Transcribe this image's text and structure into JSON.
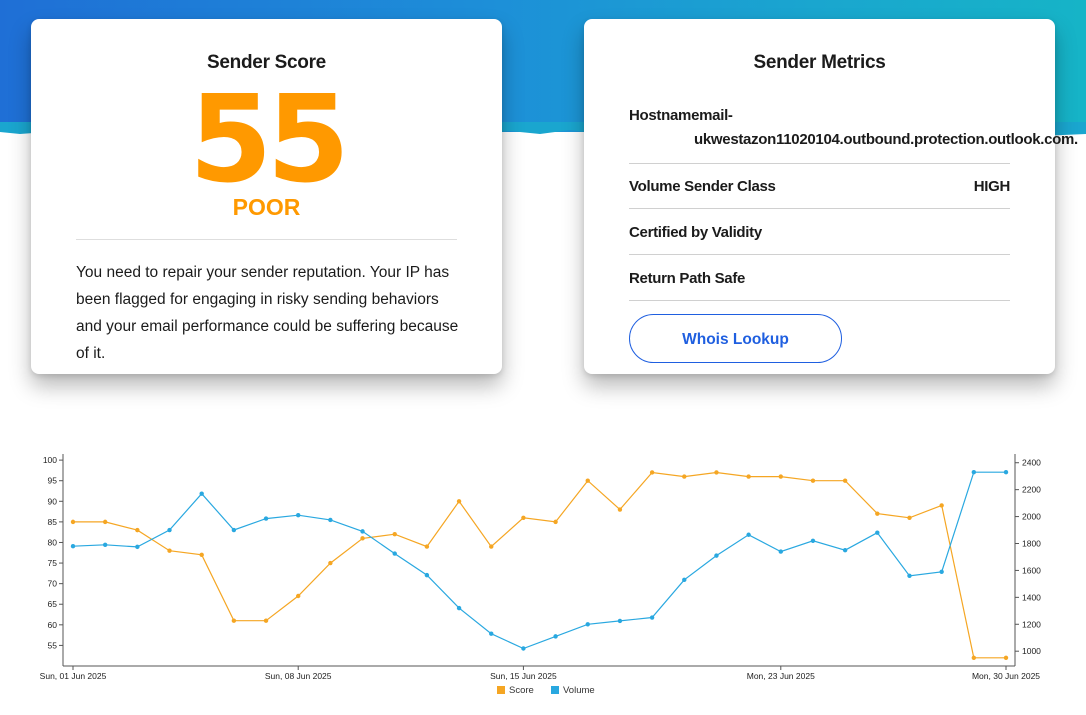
{
  "colors": {
    "accent_orange": "#ff9900",
    "link_blue": "#1f5fe0",
    "score_line": "#f5a623",
    "volume_line": "#29a8e0",
    "banner_from": "#1f6fd6",
    "banner_to": "#16b4c7"
  },
  "score_card": {
    "title": "Sender Score",
    "score": "55",
    "rating": "POOR",
    "description": "You need to repair your sender reputation. Your IP has been flagged for engaging in risky sending behaviors and your email performance could be suffering because of it."
  },
  "metrics_card": {
    "title": "Sender Metrics",
    "hostname_label": "Hostnamemail-",
    "hostname_value": "ukwestazon11020104.outbound.protection.outlook.com.",
    "volume_label": "Volume Sender Class",
    "volume_value": "HIGH",
    "certified_label": "Certified by Validity",
    "return_path_label": "Return Path Safe",
    "whois_button": "Whois Lookup"
  },
  "chart_data": {
    "type": "line",
    "x": [
      "2025-06-01",
      "2025-06-02",
      "2025-06-03",
      "2025-06-04",
      "2025-06-05",
      "2025-06-06",
      "2025-06-07",
      "2025-06-08",
      "2025-06-09",
      "2025-06-10",
      "2025-06-11",
      "2025-06-12",
      "2025-06-13",
      "2025-06-14",
      "2025-06-15",
      "2025-06-16",
      "2025-06-17",
      "2025-06-18",
      "2025-06-19",
      "2025-06-20",
      "2025-06-21",
      "2025-06-22",
      "2025-06-23",
      "2025-06-24",
      "2025-06-25",
      "2025-06-26",
      "2025-06-27",
      "2025-06-28",
      "2025-06-29",
      "2025-06-30"
    ],
    "x_tick_labels": [
      "Sun, 01 Jun 2025",
      "Sun, 08 Jun 2025",
      "Sun, 15 Jun 2025",
      "Mon, 23 Jun 2025",
      "Mon, 30 Jun 2025"
    ],
    "x_tick_dates": [
      "2025-06-01",
      "2025-06-08",
      "2025-06-15",
      "2025-06-23",
      "2025-06-30"
    ],
    "series": [
      {
        "name": "Score",
        "axis": "left",
        "color": "#f5a623",
        "values": [
          85,
          85,
          83,
          78,
          77,
          61,
          61,
          67,
          75,
          81,
          82,
          79,
          90,
          79,
          86,
          85,
          95,
          88,
          97,
          96,
          97,
          96,
          96,
          95,
          95,
          87,
          86,
          89,
          52,
          52
        ]
      },
      {
        "name": "Volume",
        "axis": "right",
        "color": "#29a8e0",
        "values": [
          1780,
          1790,
          1775,
          1900,
          2170,
          1900,
          1985,
          2010,
          1975,
          1890,
          1725,
          1565,
          1320,
          1130,
          1020,
          1110,
          1200,
          1225,
          1250,
          1530,
          1710,
          1865,
          1740,
          1820,
          1750,
          1880,
          1560,
          1590,
          2330,
          2330
        ]
      }
    ],
    "y_left": {
      "ticks": [
        55,
        60,
        65,
        70,
        75,
        80,
        85,
        90,
        95,
        100
      ],
      "ylim": [
        50,
        101
      ]
    },
    "y_right": {
      "ticks": [
        1000,
        1200,
        1400,
        1600,
        1800,
        2000,
        2200,
        2400
      ],
      "ylim": [
        890,
        2450
      ]
    },
    "legend_position": "bottom-center",
    "grid": false
  }
}
